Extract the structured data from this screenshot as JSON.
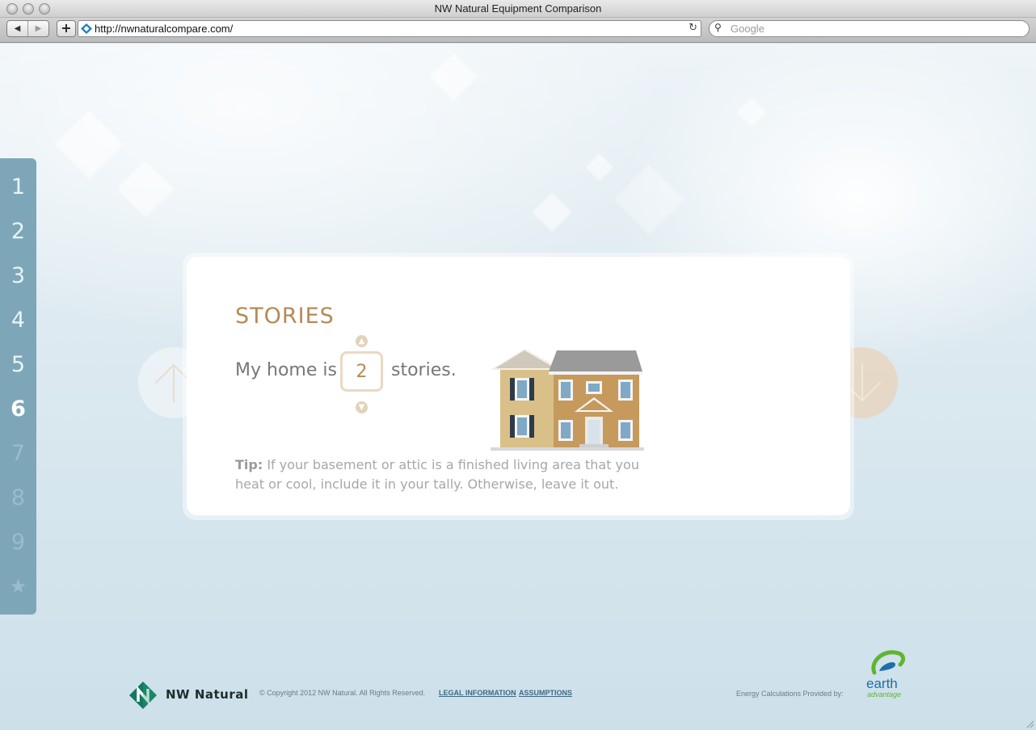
{
  "window": {
    "title": "NW Natural Equipment Comparison",
    "url": "http://nwnaturalcompare.com/",
    "search_placeholder": "Google"
  },
  "steps": {
    "items": [
      "1",
      "2",
      "3",
      "4",
      "5",
      "6",
      "7",
      "8",
      "9",
      "★"
    ],
    "current": 6
  },
  "question": {
    "title": "STORIES",
    "sentence_before": "My home is",
    "value": "2",
    "sentence_after": "stories.",
    "tip_label": "Tip:",
    "tip_text": " If your basement or attic is a finished living area that you heat or cool, include it in your tally. Otherwise, leave it out."
  },
  "footer": {
    "brand": "NW Natural",
    "copyright": "© Copyright 2012 NW Natural. All Rights Reserved.",
    "legal_link": "LEGAL INFORMATION",
    "assumptions_link": "ASSUMPTIONS",
    "energy_credit": "Energy Calculations Provided by:",
    "partner_name": "earth",
    "partner_sub": "advantage"
  },
  "colors": {
    "accent": "#b48a55",
    "rail": "#7da7b8",
    "brand_green": "#0f7a5f"
  },
  "icons": {
    "prev": "arrow-up-icon",
    "next": "arrow-down-icon"
  }
}
